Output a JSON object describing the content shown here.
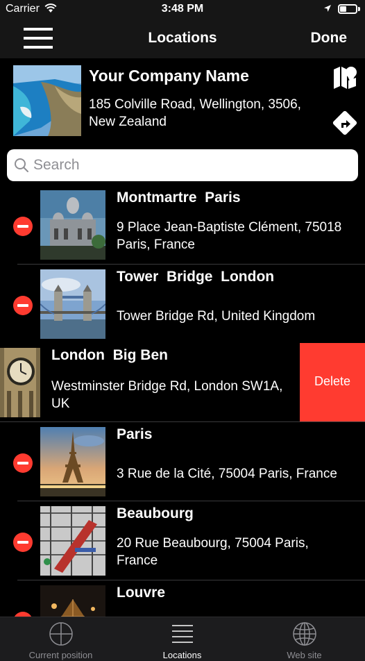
{
  "status_bar": {
    "carrier": "Carrier",
    "time": "3:48 PM"
  },
  "nav": {
    "title": "Locations",
    "done_label": "Done"
  },
  "company": {
    "name": "Your Company Name",
    "address": "185 Colville Road, Wellington, 3506, New Zealand"
  },
  "search": {
    "placeholder": "Search",
    "value": ""
  },
  "locations": [
    {
      "name": "Montmartre  Paris",
      "address": "9 Place Jean-Baptiste Clément, 75018 Paris, France"
    },
    {
      "name": "Tower  Bridge  London",
      "address": "Tower Bridge Rd, United Kingdom"
    },
    {
      "name": "London  Big Ben",
      "address": "Westminster Bridge Rd, London SW1A, UK",
      "delete_label": "Delete"
    },
    {
      "name": "Paris",
      "address": "3 Rue de la Cité, 75004 Paris, France"
    },
    {
      "name": "Beaubourg",
      "address": "20 Rue Beaubourg, 75004 Paris, France"
    },
    {
      "name": "Louvre",
      "address": ""
    }
  ],
  "tabs": [
    {
      "label": "Current position",
      "icon": "crosshair-icon",
      "active": false
    },
    {
      "label": "Locations",
      "icon": "list-icon",
      "active": true
    },
    {
      "label": "Web site",
      "icon": "globe-icon",
      "active": false
    }
  ],
  "colors": {
    "accent_red": "#ff3b30",
    "bar_background": "#161616",
    "tab_background": "#1c1c1e"
  }
}
